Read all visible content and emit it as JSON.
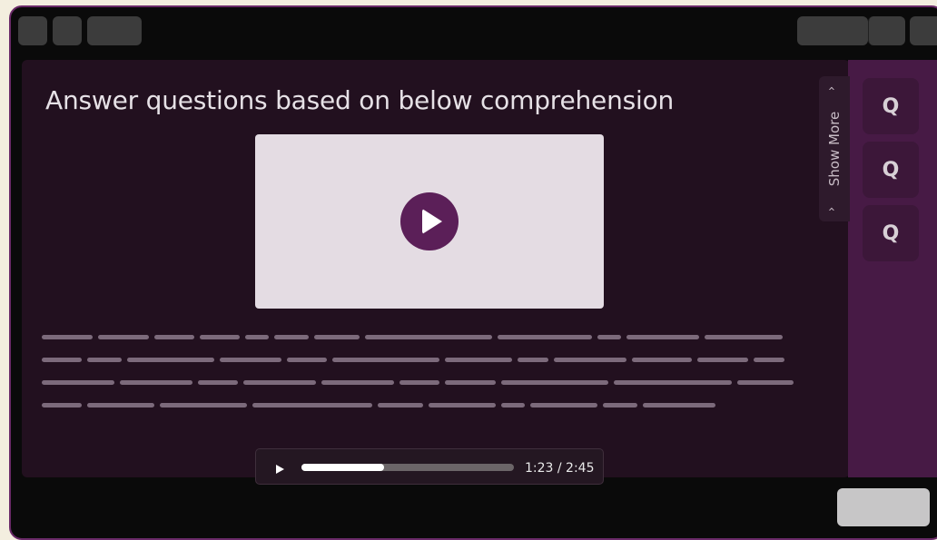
{
  "main": {
    "title": "Answer questions based on below comprehension"
  },
  "video": {
    "play_icon": "play-icon"
  },
  "audio_player": {
    "time": "1:23 / 2:45",
    "progress_fraction": 0.39
  },
  "sidebar": {
    "show_more_label": "Show More",
    "questions": [
      {
        "label": "Q"
      },
      {
        "label": "Q"
      },
      {
        "label": "Q"
      }
    ]
  },
  "colors": {
    "accent": "#5b1f58",
    "main_bg": "#22101f",
    "sidebar_bg": "#471a45",
    "page_bg": "#f3eedf"
  }
}
